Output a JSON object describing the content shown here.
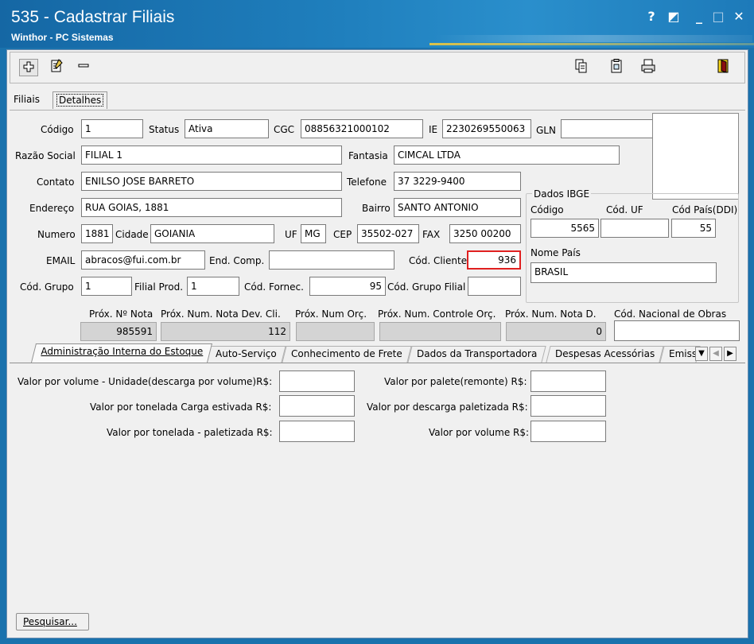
{
  "window": {
    "title": "535 - Cadastrar Filiais",
    "subtitle": "Winthor - PC Sistemas",
    "controls": [
      "?",
      "◩",
      "_",
      "□",
      "✕"
    ]
  },
  "toolbar": {
    "icons": [
      "add-icon",
      "edit-icon",
      "remove-icon",
      "copy-icon",
      "clipboard-icon",
      "print-icon",
      "exit-icon"
    ]
  },
  "tabs": [
    "Filiais",
    "Detalhes"
  ],
  "form": {
    "codigo_label": "Código",
    "codigo": "1",
    "status_label": "Status",
    "status": "Ativa",
    "cgc_label": "CGC",
    "cgc": "08856321000102",
    "ie_label": "IE",
    "ie": "2230269550063",
    "gln_label": "GLN",
    "gln": "",
    "razao_label": "Razão Social",
    "razao": "FILIAL 1",
    "fantasia_label": "Fantasia",
    "fantasia": "CIMCAL LTDA",
    "contato_label": "Contato",
    "contato": "ENILSO JOSE BARRETO",
    "telefone_label": "Telefone",
    "telefone": "37 3229-9400",
    "endereco_label": "Endereço",
    "endereco": "RUA GOIAS, 1881",
    "bairro_label": "Bairro",
    "bairro": "SANTO ANTONIO",
    "numero_label": "Numero",
    "numero": "1881",
    "cidade_label": "Cidade",
    "cidade": "GOIANIA",
    "uf_label": "UF",
    "uf": "MG",
    "cep_label": "CEP",
    "cep": "35502-027",
    "fax_label": "FAX",
    "fax": "3250 00200",
    "email_label": "EMAIL",
    "email": "abracos@fui.com.br",
    "endcomp_label": "End. Comp.",
    "endcomp": "",
    "codcliente_label": "Cód. Cliente",
    "codcliente": "936",
    "codgrupo_label": "Cód. Grupo",
    "codgrupo": "1",
    "filialprod_label": "Filial Prod.",
    "filialprod": "1",
    "codfornec_label": "Cód. Fornec.",
    "codfornec": "95",
    "codgrupofilial_label": "Cód. Grupo Filial",
    "codgrupofilial": ""
  },
  "ibge": {
    "title": "Dados IBGE",
    "codigo_label": "Código",
    "codigo": "5565",
    "coduf_label": "Cód. UF",
    "coduf": "",
    "codpais_label": "Cód País(DDI)",
    "codpais": "55",
    "nomepais_label": "Nome País",
    "nomepais": "BRASIL"
  },
  "proximos": {
    "nota_label": "Próx. Nº Nota",
    "nota": "985591",
    "notadev_label": "Próx. Num. Nota Dev. Cli.",
    "notadev": "112",
    "orc_label": "Próx. Num Orç.",
    "orc": "",
    "controleorc_label": "Próx. Num. Controle Orç.",
    "controleorc": "",
    "notad_label": "Próx. Num. Nota D.",
    "notad": "0",
    "obras_label": "Cód. Nacional de Obras",
    "obras": ""
  },
  "subtabs": [
    "Administração Interna do Estoque",
    "Auto-Serviço",
    "Conhecimento de Frete",
    "Dados da Transportadora",
    "Despesas Acessórias",
    "Emiss"
  ],
  "estoque": {
    "vol_unidade_label": "Valor por volume - Unidade(descarga por volume)R$:",
    "vol_unidade": "",
    "ton_estivada_label": "Valor por tonelada Carga estivada R$:",
    "ton_estivada": "",
    "ton_paletizada_label": "Valor por tonelada - paletizada R$:",
    "ton_paletizada": "",
    "palete_label": "Valor por palete(remonte) R$:",
    "palete": "",
    "desc_paletizada_label": "Valor por descarga paletizada R$:",
    "desc_paletizada": "",
    "volume_label": "Valor por volume R$:",
    "volume": ""
  },
  "footer": {
    "pesquisar": "Pesquisar..."
  }
}
